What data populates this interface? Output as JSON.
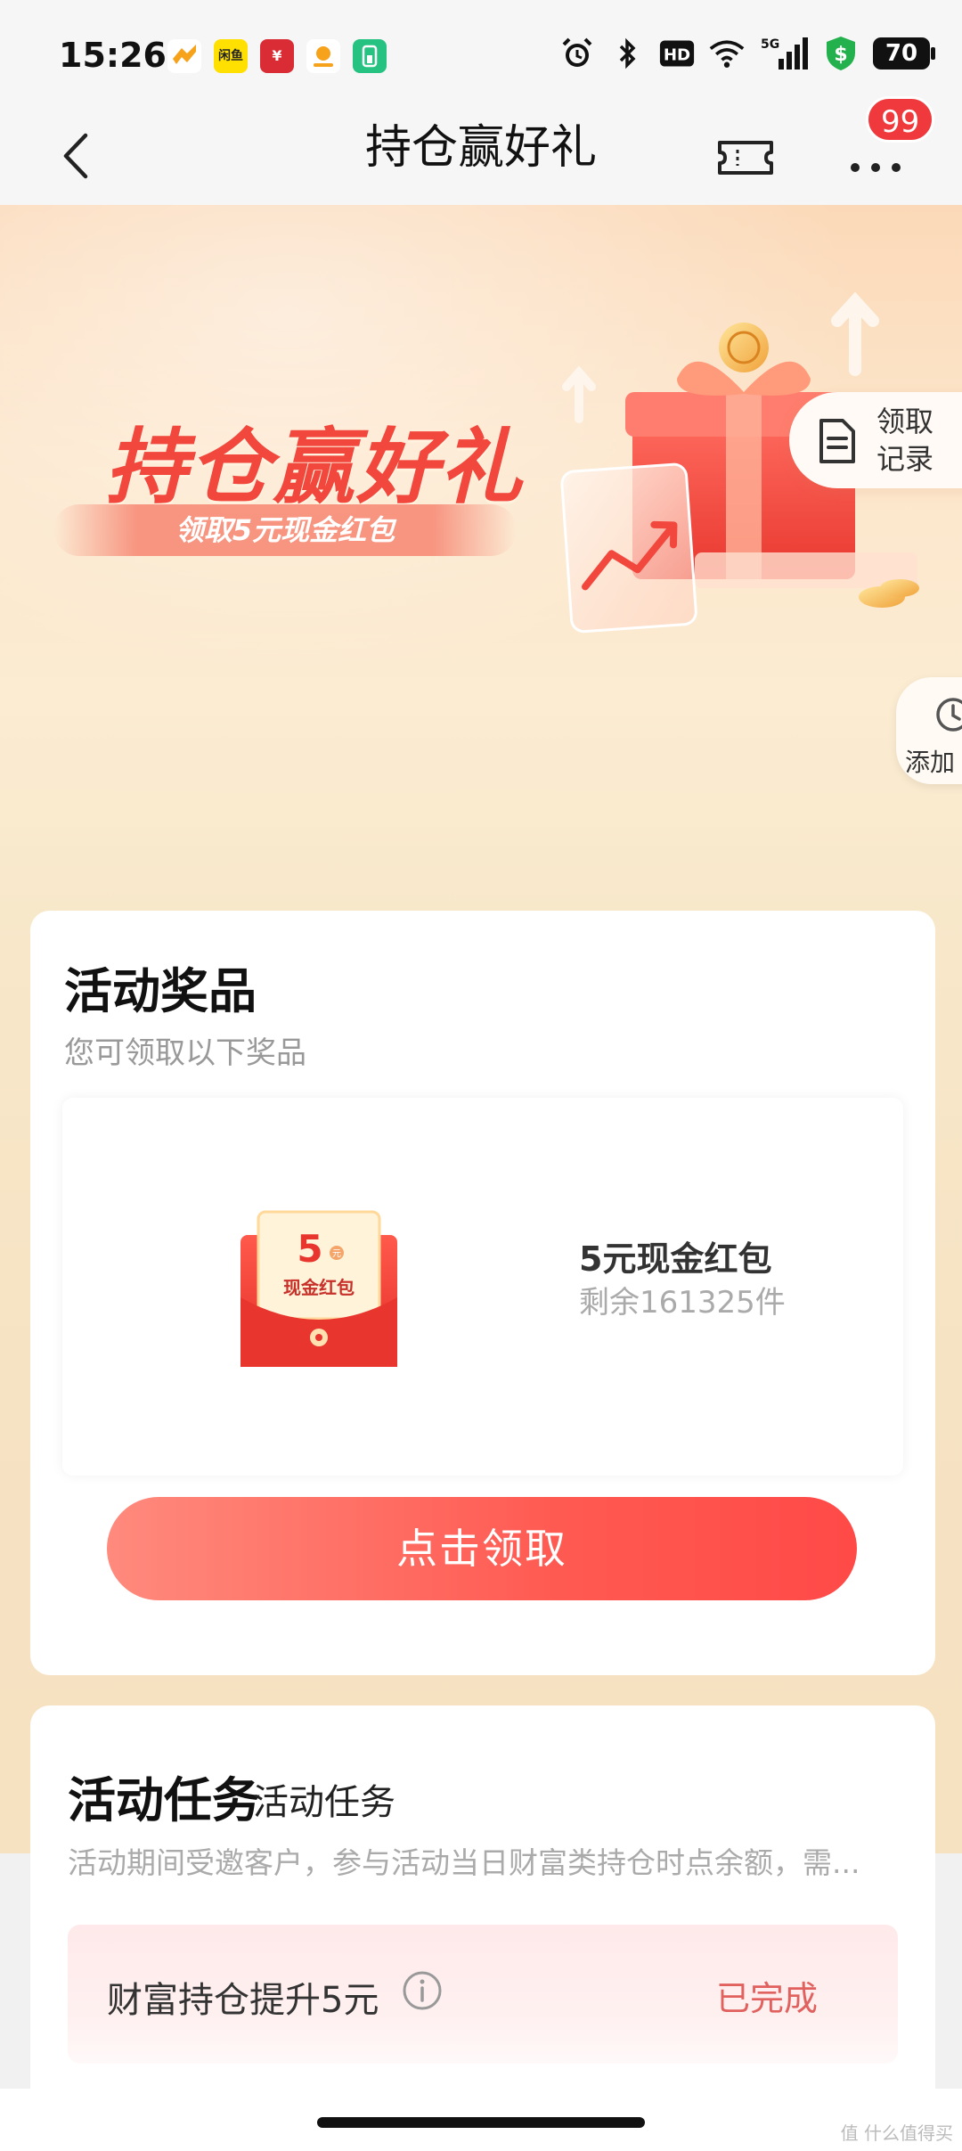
{
  "status_bar": {
    "time": "15:26",
    "apps": [
      {
        "name": "app-orange",
        "label": "",
        "color": "#f7a21b"
      },
      {
        "name": "app-xianyu",
        "label": "闲鱼",
        "color": "#ffe000"
      },
      {
        "name": "app-ecny",
        "label": "¥",
        "color": "#d92c35"
      },
      {
        "name": "app-yellow",
        "label": "",
        "color": "#ffffff"
      },
      {
        "name": "app-green",
        "label": "",
        "color": "#26c281"
      }
    ],
    "network": "5G",
    "battery": "70"
  },
  "nav": {
    "title": "持仓赢好礼",
    "badge": "99"
  },
  "hero": {
    "title": "持仓赢好礼",
    "subtitle": "领取5元现金红包",
    "records_label": "领取记录",
    "add_label": "添加"
  },
  "prize_section": {
    "title": "活动奖品",
    "subtitle": "您可领取以下奖品",
    "prize": {
      "envelope_amount": "5",
      "envelope_unit": "元",
      "envelope_label": "现金红包",
      "name": "5元现金红包",
      "remaining": "剩余161325件"
    },
    "claim_label": "点击领取"
  },
  "task_section": {
    "title": "活动任务",
    "title_small": "活动任务",
    "description": "活动期间受邀客户，参与活动当日财富类持仓时点余额，需...",
    "task": {
      "name": "财富持仓提升5元",
      "status": "已完成"
    }
  },
  "watermark": "值 什么值得买",
  "colors": {
    "accent": "#f0393d",
    "button_start": "#ff8a7d",
    "button_end": "#ff4a48",
    "status_done": "#e0615e"
  }
}
